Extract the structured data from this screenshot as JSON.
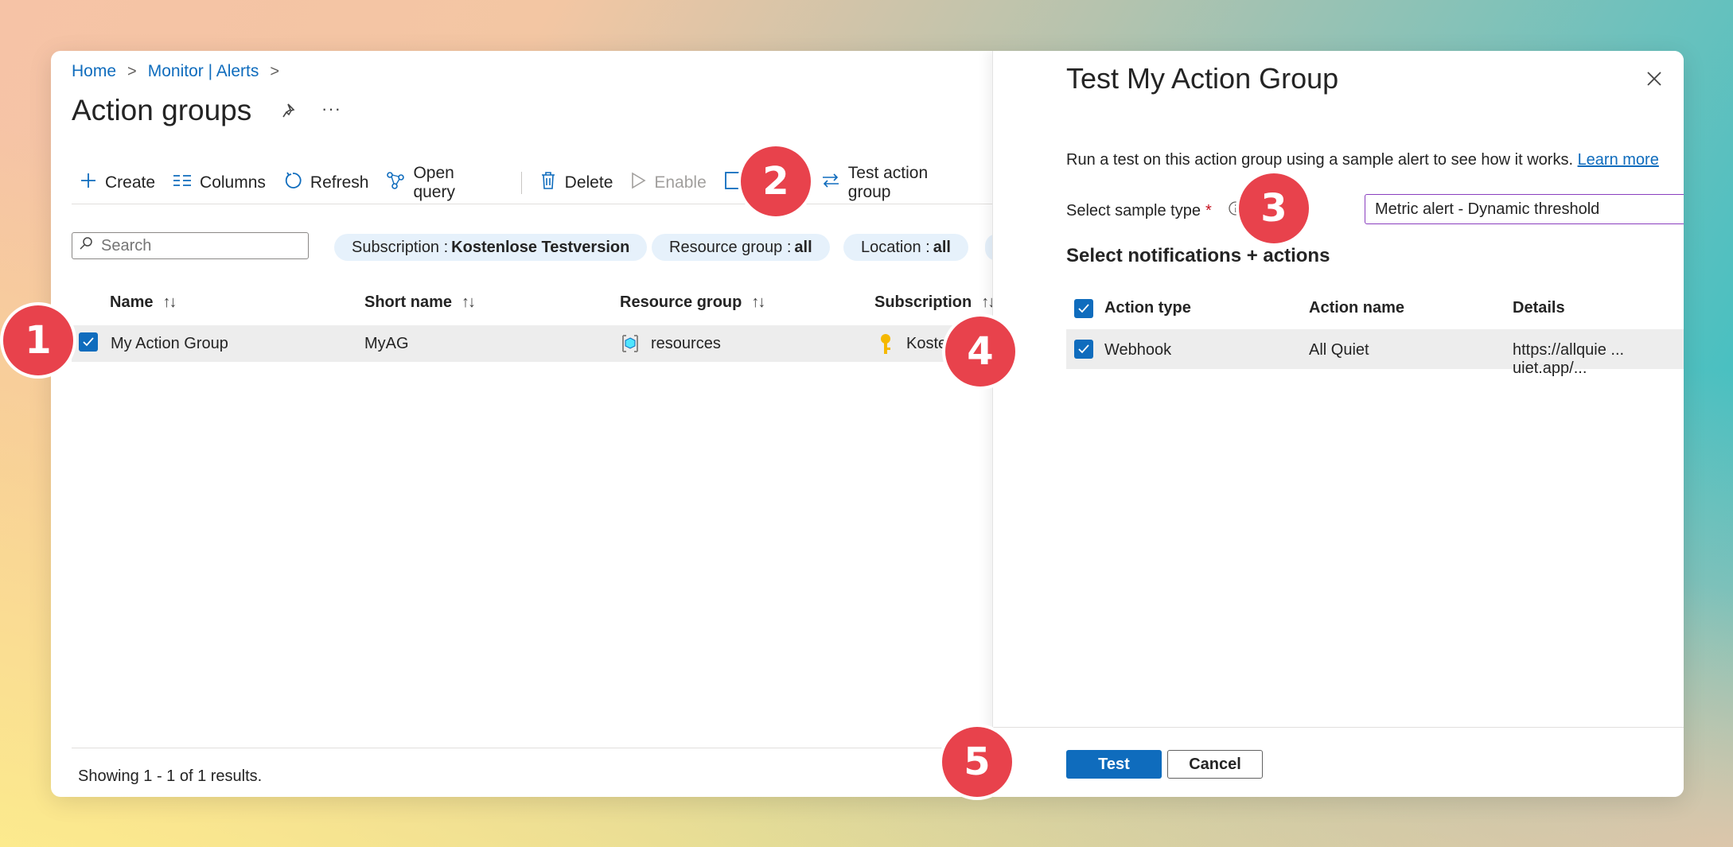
{
  "breadcrumb": {
    "home": "Home",
    "monitor": "Monitor | Alerts"
  },
  "page": {
    "title": "Action groups"
  },
  "toolbar": {
    "create": "Create",
    "columns": "Columns",
    "refresh": "Refresh",
    "open_query": "Open query",
    "delete": "Delete",
    "enable": "Enable",
    "test_action_group": "Test action group"
  },
  "search": {
    "placeholder": "Search"
  },
  "filters": [
    {
      "label": "Subscription : ",
      "value": "Kostenlose Testversion"
    },
    {
      "label": "Resource group : ",
      "value": "all"
    },
    {
      "label": "Location : ",
      "value": "all"
    }
  ],
  "table": {
    "headers": [
      "Name",
      "Short name",
      "Resource group",
      "Subscription"
    ],
    "rows": [
      {
        "name": "My Action Group",
        "short_name": "MyAG",
        "resource_group": "resources",
        "subscription": "Kosten"
      }
    ]
  },
  "footer": {
    "results": "Showing 1 - 1 of 1 results."
  },
  "panel": {
    "title": "Test My Action Group",
    "description": "Run a test on this action group using a sample alert to see how it works. ",
    "learn_more": "Learn more",
    "sample_type_label": "Select sample type",
    "required_mark": "*",
    "sample_type_value": "Metric alert - Dynamic threshold",
    "section_title": "Select notifications + actions",
    "headers": [
      "Action type",
      "Action name",
      "Details"
    ],
    "rows": [
      {
        "type": "Webhook",
        "name": "All Quiet",
        "details": "https://allquie ... uiet.app/..."
      }
    ],
    "test_button": "Test",
    "cancel_button": "Cancel"
  },
  "markers": [
    "1",
    "2",
    "3",
    "4",
    "5"
  ],
  "colors": {
    "accent": "#0f6cbd",
    "marker": "#e8424c"
  }
}
